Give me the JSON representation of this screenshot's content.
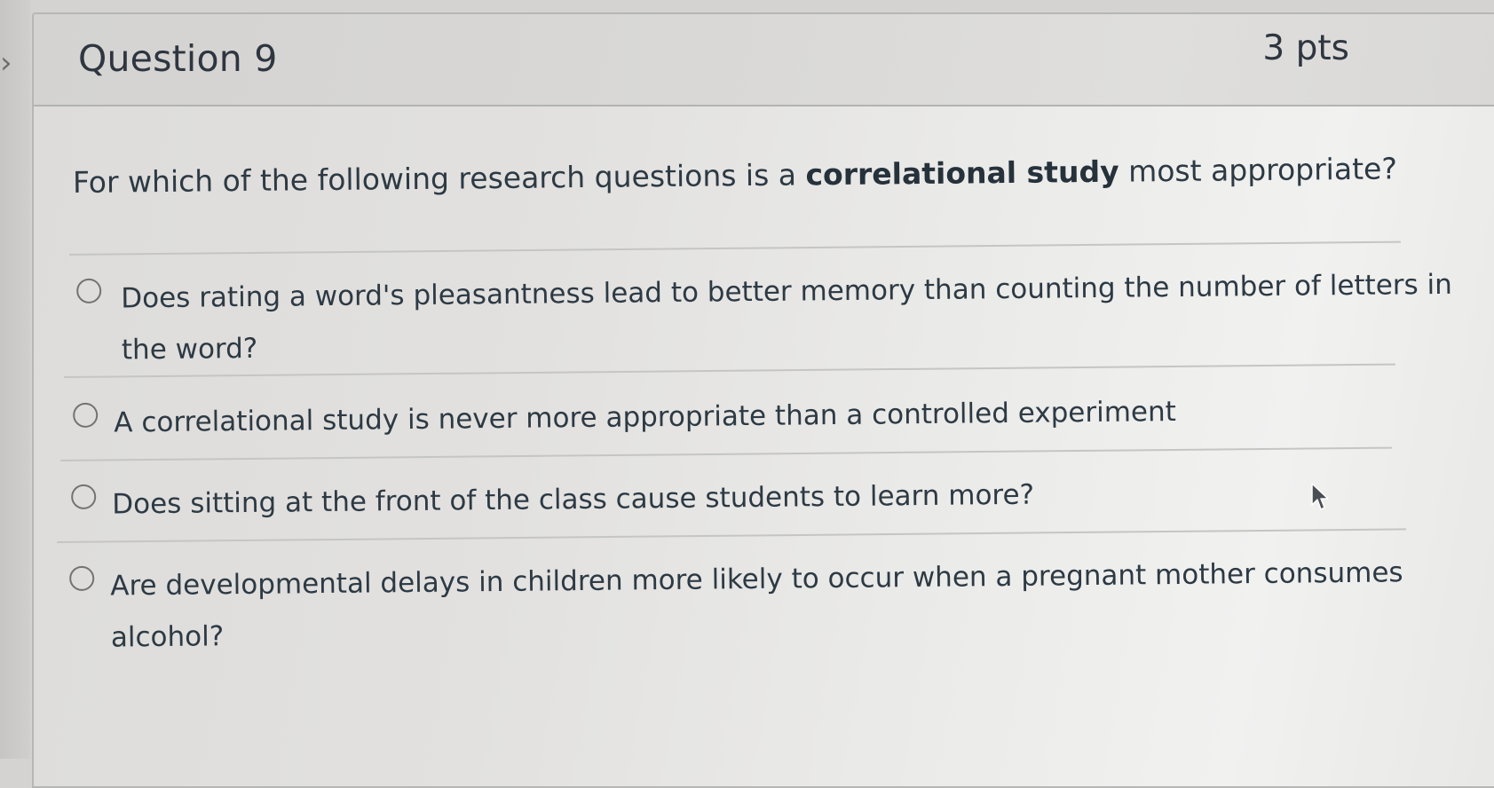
{
  "question": {
    "title": "Question 9",
    "points": "3 pts",
    "text_before": "For which of the following research questions is a ",
    "text_bold": "correlational study",
    "text_after": " most appropriate?"
  },
  "answers": [
    {
      "line1": "Does rating a word's pleasantness lead to better memory than counting the number of letters in",
      "line2": "the word?",
      "selected": false
    },
    {
      "line1": "A correlational study is never more appropriate than a controlled experiment",
      "line2": "",
      "selected": false
    },
    {
      "line1": "Does sitting at the front of the class cause students to learn more?",
      "line2": "",
      "selected": false
    },
    {
      "line1": "Are developmental delays in children more likely to occur when a pregnant mother consumes",
      "line2": "alcohol?",
      "selected": false
    }
  ],
  "colors": {
    "text": "#2d3a44",
    "radio_border": "#737373",
    "divider": "#c5c5c3"
  },
  "icons": {
    "collapse": "chevron-right-icon",
    "radio": "radio-unselected-icon",
    "cursor": "mouse-pointer-icon"
  }
}
